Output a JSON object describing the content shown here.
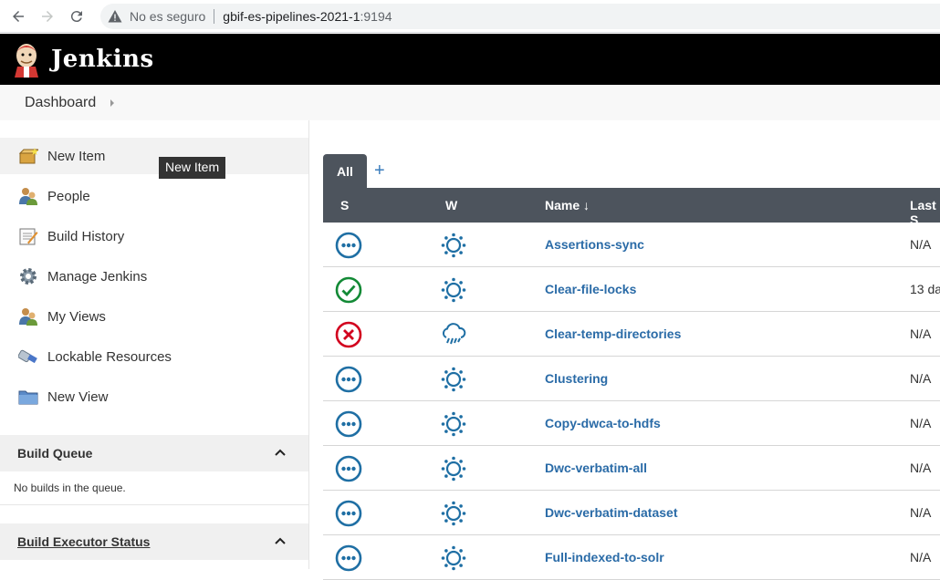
{
  "browser": {
    "security": "No es seguro",
    "host": "gbif-es-pipelines-2021-1",
    "port": ":9194"
  },
  "header": {
    "brand": "Jenkins"
  },
  "breadcrumb": {
    "dashboard": "Dashboard"
  },
  "sidebar": {
    "tasks": [
      {
        "label": "New Item",
        "icon": "new-item-icon"
      },
      {
        "label": "People",
        "icon": "people-icon"
      },
      {
        "label": "Build History",
        "icon": "notepad-icon"
      },
      {
        "label": "Manage Jenkins",
        "icon": "gear-icon"
      },
      {
        "label": "My Views",
        "icon": "people-icon"
      },
      {
        "label": "Lockable Resources",
        "icon": "usb-icon"
      },
      {
        "label": "New View",
        "icon": "folder-icon"
      }
    ],
    "tooltip": "New Item",
    "build_queue": {
      "title": "Build Queue",
      "empty": "No builds in the queue."
    },
    "executor": {
      "title": "Build Executor Status"
    }
  },
  "main": {
    "tab_all": "All",
    "tab_add": "+",
    "columns": {
      "s": "S",
      "w": "W",
      "name": "Name ↓",
      "last": "Last S"
    },
    "rows": [
      {
        "status": "notbuilt",
        "weather": "sunny",
        "name": "Assertions-sync",
        "last": "N/A"
      },
      {
        "status": "success",
        "weather": "sunny",
        "name": "Clear-file-locks",
        "last": "13 da"
      },
      {
        "status": "failed",
        "weather": "rain",
        "name": "Clear-temp-directories",
        "last": "N/A"
      },
      {
        "status": "notbuilt",
        "weather": "sunny",
        "name": "Clustering",
        "last": "N/A"
      },
      {
        "status": "notbuilt",
        "weather": "sunny",
        "name": "Copy-dwca-to-hdfs",
        "last": "N/A"
      },
      {
        "status": "notbuilt",
        "weather": "sunny",
        "name": "Dwc-verbatim-all",
        "last": "N/A"
      },
      {
        "status": "notbuilt",
        "weather": "sunny",
        "name": "Dwc-verbatim-dataset",
        "last": "N/A"
      },
      {
        "status": "notbuilt",
        "weather": "sunny",
        "name": "Full-indexed-to-solr",
        "last": "N/A"
      }
    ]
  },
  "colors": {
    "link": "#2a6ba7",
    "success": "#138a36",
    "failed": "#d2001e",
    "notbuilt": "#1f6fa4"
  }
}
